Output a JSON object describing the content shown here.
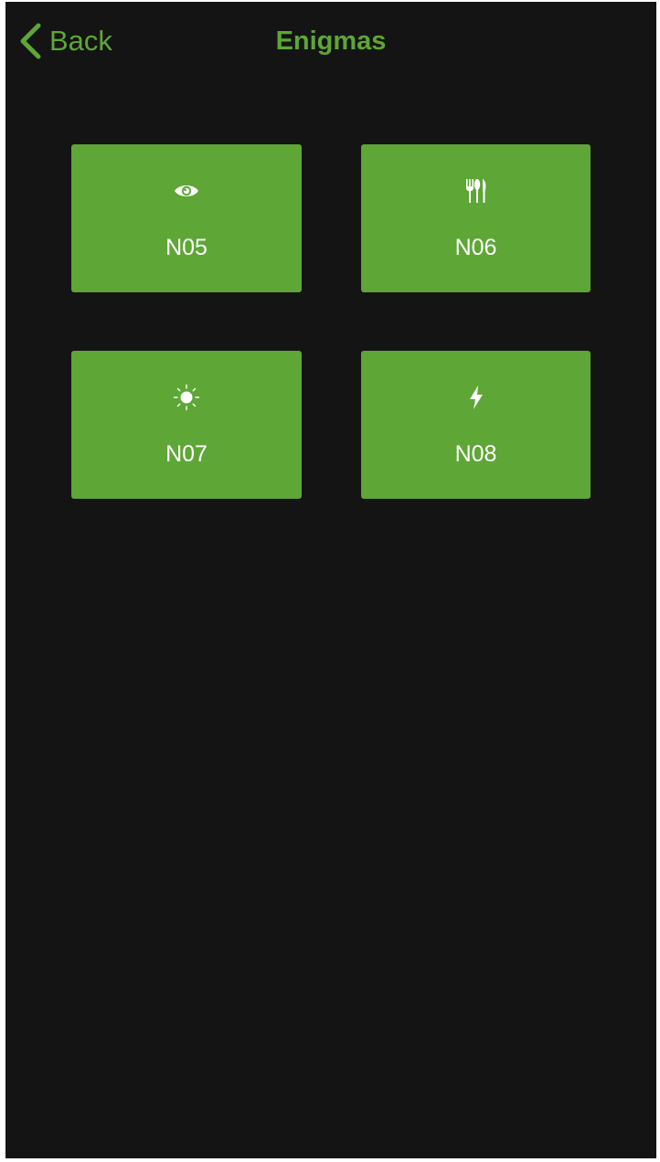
{
  "navbar": {
    "back_label": "Back",
    "back_icon": "chevron-left-icon",
    "title": "Enigmas"
  },
  "tiles": [
    {
      "label": "N05",
      "icon": "eye-icon"
    },
    {
      "label": "N06",
      "icon": "cutlery-icon"
    },
    {
      "label": "N07",
      "icon": "sun-icon"
    },
    {
      "label": "N08",
      "icon": "lightning-bolt-icon"
    }
  ],
  "colors": {
    "background": "#141414",
    "accent": "#5ea636",
    "tile_text": "#ffffff"
  }
}
